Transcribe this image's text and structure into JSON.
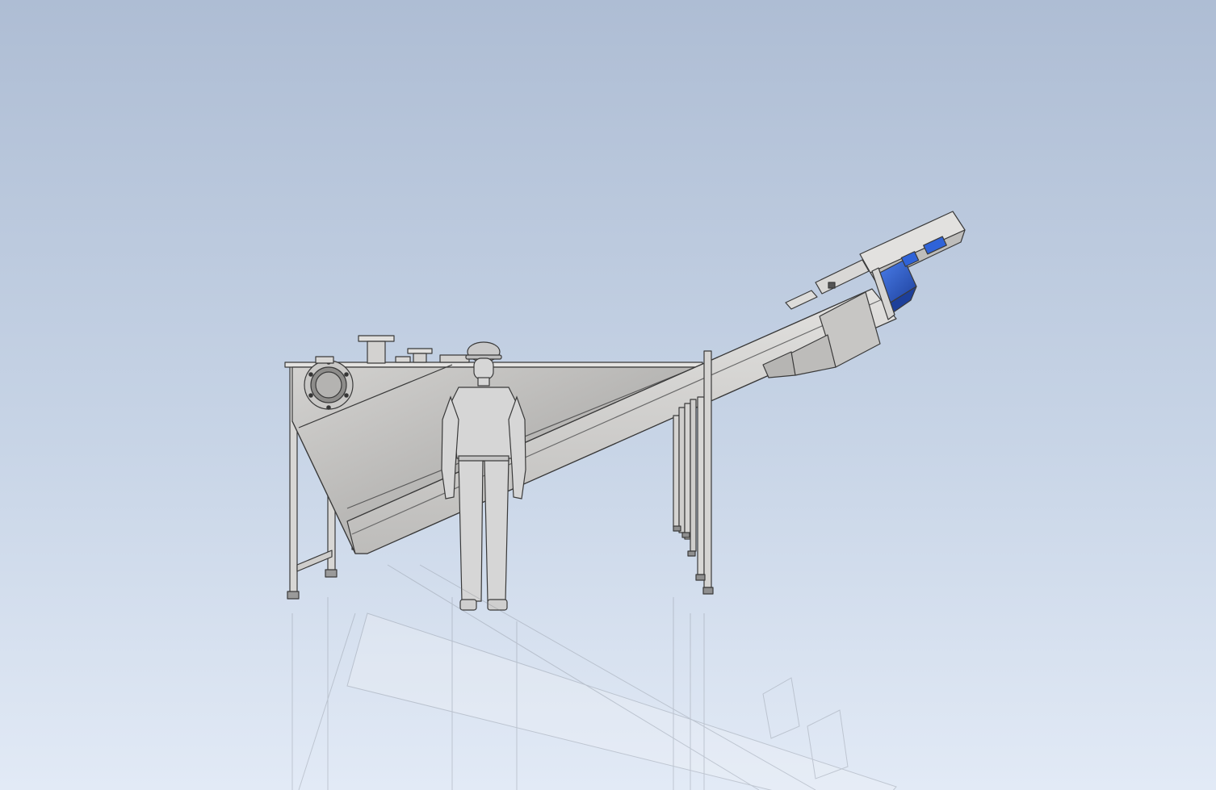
{
  "scene": {
    "background_top": "#aebdd4",
    "background_mid": "#c7d4e6",
    "background_bottom": "#e2eaf6",
    "steel_light": "#dcdbd9",
    "steel_mid": "#c9c8c6",
    "steel_dark": "#a9a8a6",
    "outline": "#3a3a3a",
    "motor_blue": "#2f63d8",
    "motor_blue_dark": "#1d3f9a",
    "figure_fill": "#d6d6d6",
    "reflection_opacity": 0.28
  },
  "icons": {
    "viewport": "cad-3d-viewport",
    "machine": "inclined-screw-conveyor-icon",
    "tank": "hopper-tank-icon",
    "motor": "gear-motor-icon",
    "worker": "human-scale-figure-icon",
    "porthole": "inspection-porthole-icon"
  }
}
